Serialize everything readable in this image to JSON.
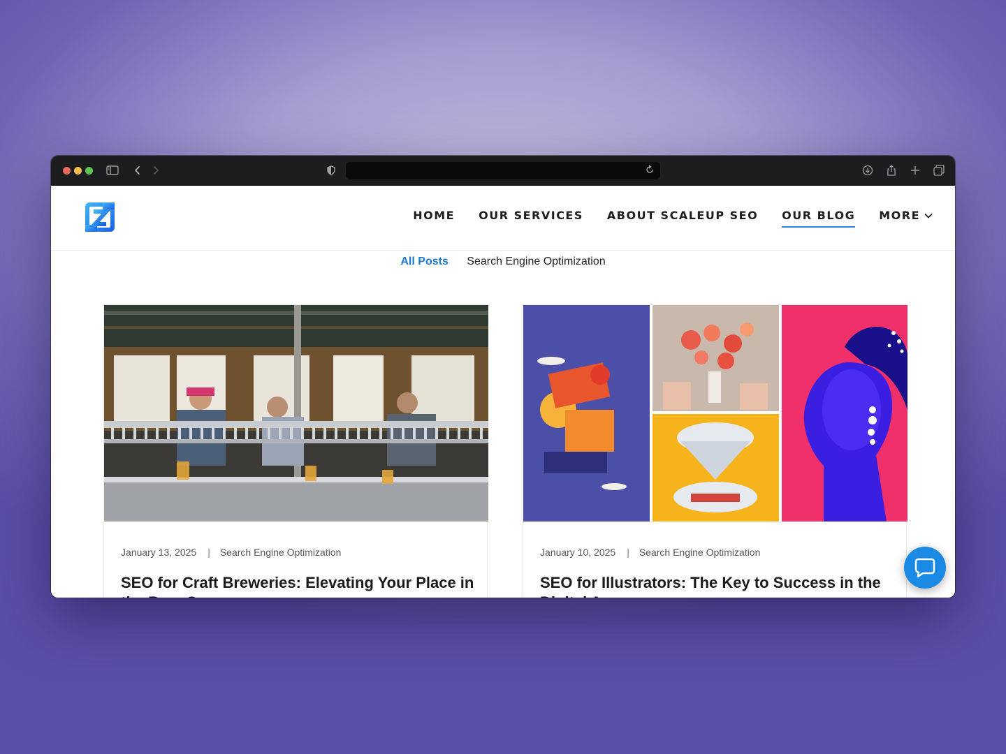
{
  "browser": {
    "url": "",
    "toolbar_icons": [
      "sidebar-icon",
      "back-icon",
      "forward-icon",
      "shield-icon",
      "reload-icon",
      "download-icon",
      "share-icon",
      "new-tab-icon",
      "tabs-overview-icon"
    ]
  },
  "site": {
    "logo": "scaleup-seo-logo",
    "nav": [
      {
        "label": "HOME",
        "active": false
      },
      {
        "label": "OUR SERVICES",
        "active": false
      },
      {
        "label": "ABOUT SCALEUP SEO",
        "active": false
      },
      {
        "label": "OUR BLOG",
        "active": true
      },
      {
        "label": "MORE",
        "active": false,
        "dropdown": true
      }
    ],
    "accent_color": "#1a7bd1"
  },
  "filters": {
    "active": "All Posts",
    "items": [
      "Search Engine Optimization"
    ]
  },
  "posts": [
    {
      "date": "January 13, 2025",
      "separator": "|",
      "category": "Search Engine Optimization",
      "title": "SEO for Craft Breweries: Elevating Your Place in the Beer Scene",
      "image": "brewery-taps-photo"
    },
    {
      "date": "January 10, 2025",
      "separator": "|",
      "category": "Search Engine Optimization",
      "title": "SEO for Illustrators: The Key to Success in the Digital Age",
      "image": "illustration-collage"
    }
  ],
  "chat": {
    "icon": "chat-bubble-icon",
    "color": "#1a8ae5"
  }
}
